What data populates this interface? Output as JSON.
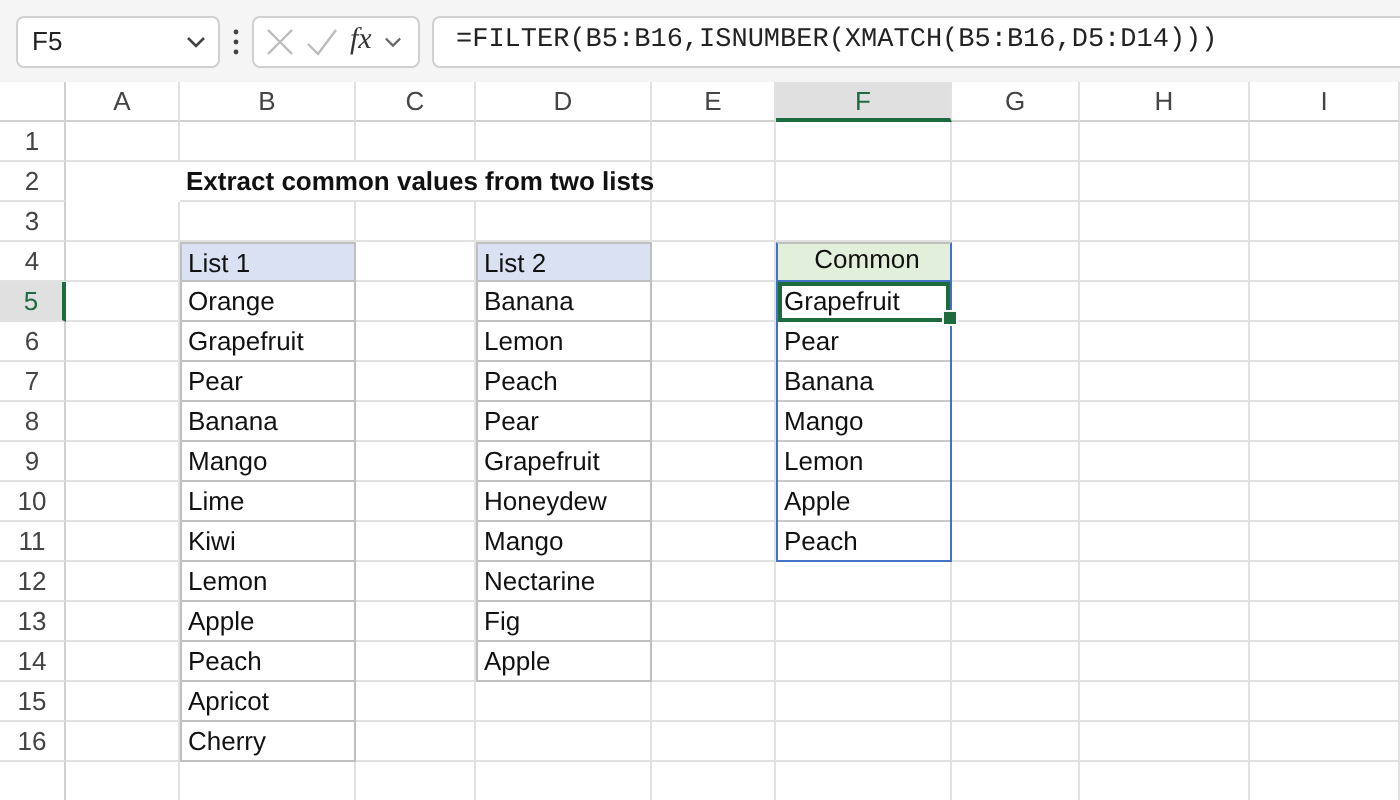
{
  "name_box": "F5",
  "function_button": "fx",
  "formula": "=FILTER(B5:B16,ISNUMBER(XMATCH(B5:B16,D5:D14)))",
  "columns": [
    {
      "label": "A",
      "selected": false
    },
    {
      "label": "B",
      "selected": false
    },
    {
      "label": "C",
      "selected": false
    },
    {
      "label": "D",
      "selected": false
    },
    {
      "label": "E",
      "selected": false
    },
    {
      "label": "F",
      "selected": true
    },
    {
      "label": "G",
      "selected": false
    },
    {
      "label": "H",
      "selected": false
    },
    {
      "label": "I",
      "selected": false
    }
  ],
  "rows": [
    {
      "label": "1",
      "selected": false
    },
    {
      "label": "2",
      "selected": false
    },
    {
      "label": "3",
      "selected": false
    },
    {
      "label": "4",
      "selected": false
    },
    {
      "label": "5",
      "selected": true
    },
    {
      "label": "6",
      "selected": false
    },
    {
      "label": "7",
      "selected": false
    },
    {
      "label": "8",
      "selected": false
    },
    {
      "label": "9",
      "selected": false
    },
    {
      "label": "10",
      "selected": false
    },
    {
      "label": "11",
      "selected": false
    },
    {
      "label": "12",
      "selected": false
    },
    {
      "label": "13",
      "selected": false
    },
    {
      "label": "14",
      "selected": false
    },
    {
      "label": "15",
      "selected": false
    },
    {
      "label": "16",
      "selected": false
    }
  ],
  "title": "Extract common values from two lists",
  "tables": [
    {
      "kind": "input",
      "header": "List 1",
      "values": [
        {
          "text": "Orange",
          "selected": false
        },
        {
          "text": "Grapefruit",
          "selected": false
        },
        {
          "text": "Pear",
          "selected": false
        },
        {
          "text": "Banana",
          "selected": false
        },
        {
          "text": "Mango",
          "selected": false
        },
        {
          "text": "Lime",
          "selected": false
        },
        {
          "text": "Kiwi",
          "selected": false
        },
        {
          "text": "Lemon",
          "selected": false
        },
        {
          "text": "Apple",
          "selected": false
        },
        {
          "text": "Peach",
          "selected": false
        },
        {
          "text": "Apricot",
          "selected": false
        },
        {
          "text": "Cherry",
          "selected": false
        }
      ]
    },
    {
      "kind": "input",
      "header": "List 2",
      "values": [
        {
          "text": "Banana",
          "selected": false
        },
        {
          "text": "Lemon",
          "selected": false
        },
        {
          "text": "Peach",
          "selected": false
        },
        {
          "text": "Pear",
          "selected": false
        },
        {
          "text": "Grapefruit",
          "selected": false
        },
        {
          "text": "Honeydew",
          "selected": false
        },
        {
          "text": "Mango",
          "selected": false
        },
        {
          "text": "Nectarine",
          "selected": false
        },
        {
          "text": "Fig",
          "selected": false
        },
        {
          "text": "Apple",
          "selected": false
        }
      ]
    },
    {
      "kind": "spill",
      "header": "Common",
      "values": [
        {
          "text": "Grapefruit",
          "selected": true
        },
        {
          "text": "Pear",
          "selected": false
        },
        {
          "text": "Banana",
          "selected": false
        },
        {
          "text": "Mango",
          "selected": false
        },
        {
          "text": "Lemon",
          "selected": false
        },
        {
          "text": "Apple",
          "selected": false
        },
        {
          "text": "Peach",
          "selected": false
        }
      ]
    }
  ]
}
